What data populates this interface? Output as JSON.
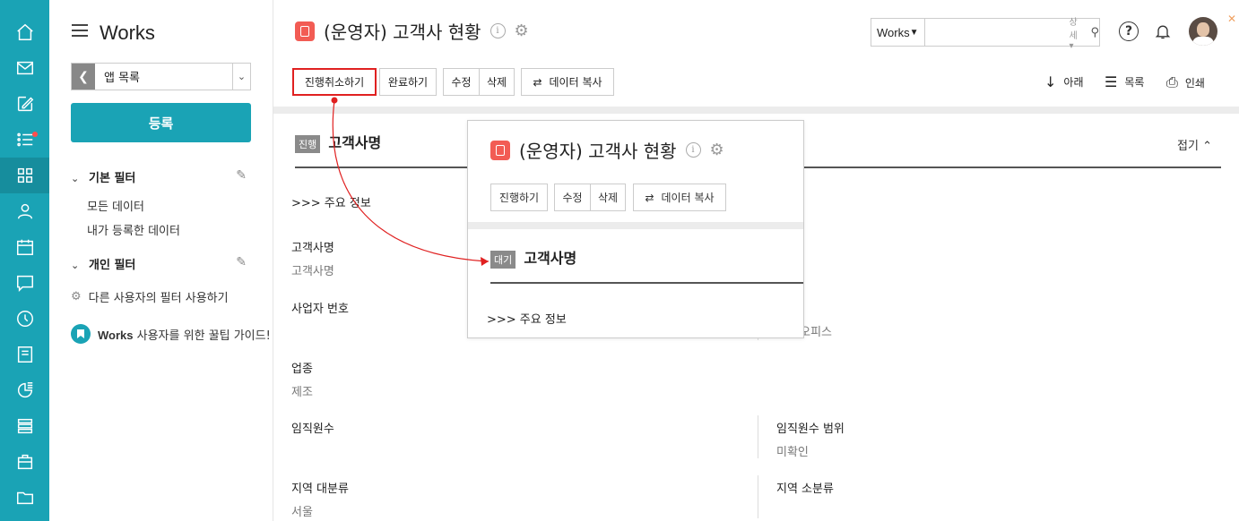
{
  "rail": {
    "items": [
      {
        "icon": "home-icon"
      },
      {
        "icon": "mail-icon"
      },
      {
        "icon": "edit-icon"
      },
      {
        "icon": "tasks-icon",
        "has_dot": true
      },
      {
        "icon": "apps-grid-icon",
        "active": true
      },
      {
        "icon": "person-icon"
      },
      {
        "icon": "calendar-icon"
      },
      {
        "icon": "chat-icon"
      },
      {
        "icon": "clock-icon"
      },
      {
        "icon": "board-icon"
      },
      {
        "icon": "report-icon"
      },
      {
        "icon": "list-icon"
      },
      {
        "icon": "briefcase-icon"
      },
      {
        "icon": "folder-icon"
      }
    ],
    "accent": "#1aa3b5",
    "dot_color": "#ff4d4d"
  },
  "sidebar": {
    "title": "Works",
    "app_select": "앱 목록",
    "register_button": "등록",
    "basic_filter": "기본 필터",
    "all_data": "모든 데이터",
    "my_data": "내가 등록한 데이터",
    "personal_filter": "개인 필터",
    "use_others_filter": "다른 사용자의 필터 사용하기",
    "guide_brand": "Works",
    "guide_text": " 사용자를 위한 꿀팁 가이드!"
  },
  "header": {
    "title": "(운영자) 고객사 현황",
    "search_scope": "Works",
    "search_placeholder": "",
    "search_advanced": "상세",
    "help": "?"
  },
  "toolbar": {
    "cancel_progress": "진행취소하기",
    "complete": "완료하기",
    "edit": "수정",
    "delete": "삭제",
    "copy_data": "데이터 복사",
    "down": "아래",
    "list": "목록",
    "print": "인쇄"
  },
  "record": {
    "status_badge": "진행",
    "name": "고객사명",
    "fold": "접기",
    "main_info": ">>> 주요 정보",
    "fields": {
      "customer_name_label": "고객사명",
      "customer_name_value": "고객사명",
      "business_no_label": "사업자 번호",
      "office_value_partial": "오피스",
      "industry_label": "업종",
      "industry_value": "제조",
      "employees_label": "임직원수",
      "employees_range_label": "임직원수 범위",
      "employees_range_value": "미확인",
      "region_major_label": "지역 대분류",
      "region_major_value": "서울",
      "region_minor_label": "지역 소분류"
    }
  },
  "popup": {
    "title": "(운영자) 고객사 현황",
    "proceed": "진행하기",
    "edit": "수정",
    "delete": "삭제",
    "copy_data": "데이터 복사",
    "status_badge": "대기",
    "name": "고객사명",
    "main_info": ">>> 주요 정보"
  },
  "colors": {
    "highlight": "#e02020",
    "app_icon": "#f25c54"
  }
}
